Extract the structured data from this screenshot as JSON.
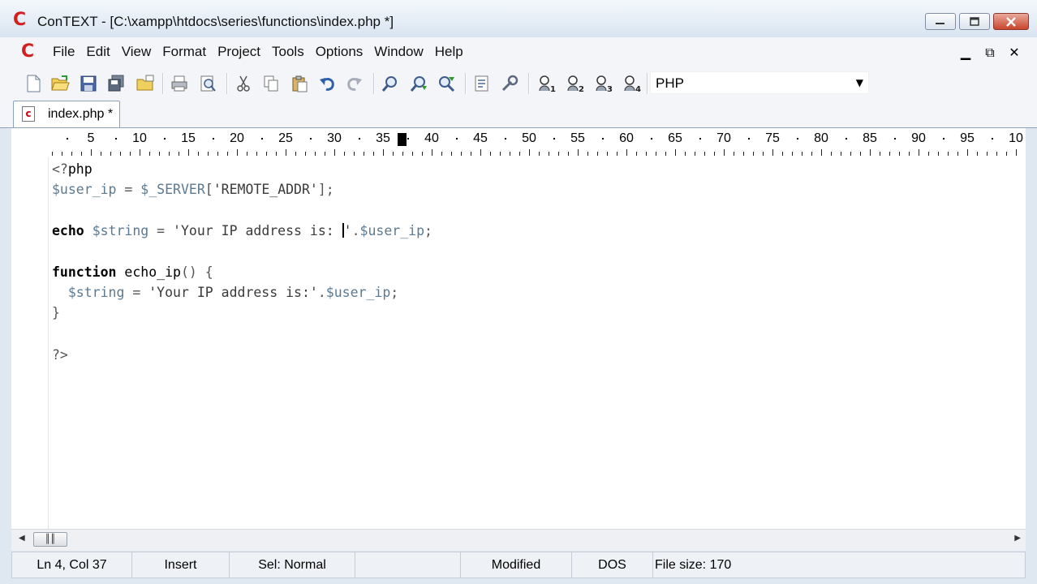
{
  "window": {
    "title": "ConTEXT - [C:\\xampp\\htdocs\\series\\functions\\index.php *]",
    "app_icon_letter": "C"
  },
  "menu": {
    "items": [
      "File",
      "Edit",
      "View",
      "Format",
      "Project",
      "Tools",
      "Options",
      "Window",
      "Help"
    ]
  },
  "toolbar": {
    "language": "PHP",
    "user_command_numbers": [
      "1",
      "2",
      "3",
      "4"
    ]
  },
  "tab": {
    "label": "index.php *",
    "icon_letter": "c"
  },
  "ruler": {
    "labels": [
      "5",
      "10",
      "15",
      "20",
      "25",
      "30",
      "35",
      "40",
      "45",
      "50",
      "55",
      "60",
      "65",
      "70",
      "75",
      "80",
      "85",
      "90",
      "95",
      "10"
    ],
    "cursor_column": 37
  },
  "editor": {
    "lines": [
      "<?php",
      "$user_ip = $_SERVER['REMOTE_ADDR'];",
      "",
      "echo $string = 'Your IP address is: '.$user_ip;",
      "",
      "function echo_ip() {",
      "  $string = 'Your IP address is:'.$user_ip;",
      "}",
      "",
      "?>"
    ]
  },
  "statusbar": {
    "position": "Ln 4, Col 37",
    "mode": "Insert",
    "selection": "Sel: Normal",
    "modified": "Modified",
    "line_ending": "DOS",
    "file_size": "File size: 170"
  },
  "colors": {
    "variable": "#5a7a94",
    "keyword": "#000000",
    "app_icon": "#d21f1f"
  }
}
